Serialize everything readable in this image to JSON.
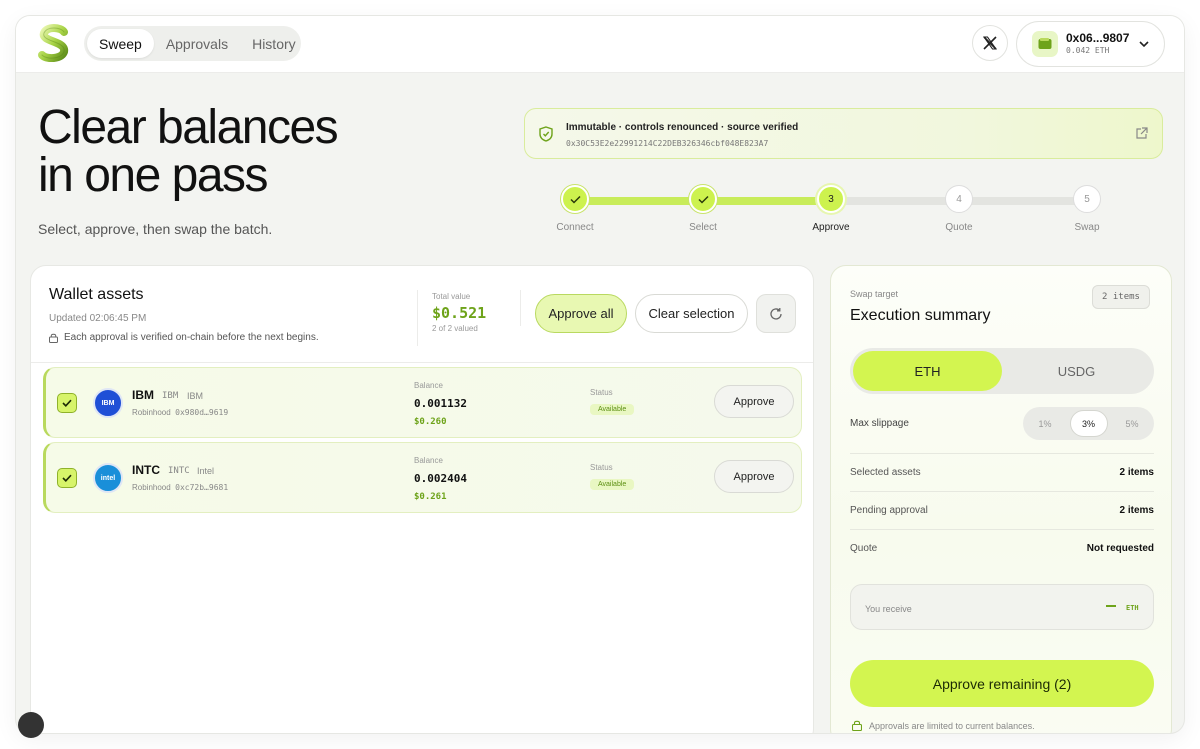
{
  "header": {
    "nav": [
      {
        "label": "Sweep",
        "active": true
      },
      {
        "label": "Approvals",
        "active": false
      },
      {
        "label": "History",
        "active": false
      }
    ],
    "x_icon": "x-logo-icon",
    "wallet": {
      "address": "0x06...9807",
      "balance": "0.042 ETH",
      "icon": "wallet-icon"
    }
  },
  "hero": {
    "title_line1": "Clear balances",
    "title_line2": "in one pass",
    "subtitle": "Select, approve, then swap the batch."
  },
  "verified": {
    "title": "Immutable · controls renounced · source verified",
    "contract": "0x30C53E2e22991214C22DEB326346cbf048E823A7"
  },
  "steps": [
    {
      "label": "Connect",
      "state": "done",
      "num": "1"
    },
    {
      "label": "Select",
      "state": "done",
      "num": "2"
    },
    {
      "label": "Approve",
      "state": "active",
      "num": "3"
    },
    {
      "label": "Quote",
      "state": "todo",
      "num": "4"
    },
    {
      "label": "Swap",
      "state": "todo",
      "num": "5"
    }
  ],
  "assets": {
    "title": "Wallet assets",
    "updated": "Updated 02:06:45 PM",
    "note": "Each approval is verified on-chain before the next begins.",
    "total_label": "Total value",
    "total_value": "$0.521",
    "total_sub": "2 of 2 valued",
    "approve_all": "Approve all",
    "clear_selection": "Clear selection",
    "balance_label": "Balance",
    "status_label": "Status",
    "rows": [
      {
        "symbol": "IBM",
        "ticker": "IBM",
        "name": "IBM",
        "source": "Robinhood",
        "addr": "0x980d…9619",
        "balance": "0.001132",
        "usd": "$0.260",
        "status": "Available",
        "action": "Approve",
        "color": "#1f4fd6",
        "logo": "IBM"
      },
      {
        "symbol": "INTC",
        "ticker": "INTC",
        "name": "Intel",
        "source": "Robinhood",
        "addr": "0xc72b…9681",
        "balance": "0.002404",
        "usd": "$0.261",
        "status": "Available",
        "action": "Approve",
        "color": "#1a8fd9",
        "logo": "intel"
      }
    ]
  },
  "summary": {
    "label": "Swap target",
    "title": "Execution summary",
    "items_badge": "2 items",
    "targets": [
      {
        "label": "ETH",
        "active": true
      },
      {
        "label": "USDG",
        "active": false
      }
    ],
    "slippage_label": "Max slippage",
    "slippage": [
      {
        "label": "1%",
        "active": false
      },
      {
        "label": "3%",
        "active": true
      },
      {
        "label": "5%",
        "active": false
      }
    ],
    "rows": [
      {
        "label": "Selected assets",
        "value": "2 items"
      },
      {
        "label": "Pending approval",
        "value": "2 items"
      },
      {
        "label": "Quote",
        "value": "Not requested"
      }
    ],
    "receive_label": "You receive",
    "receive_currency": "ETH",
    "cta": "Approve remaining (2)",
    "footnote": "Approvals are limited to current balances."
  },
  "colors": {
    "accent": "#d3f550",
    "accent_dark": "#6ea31a"
  }
}
